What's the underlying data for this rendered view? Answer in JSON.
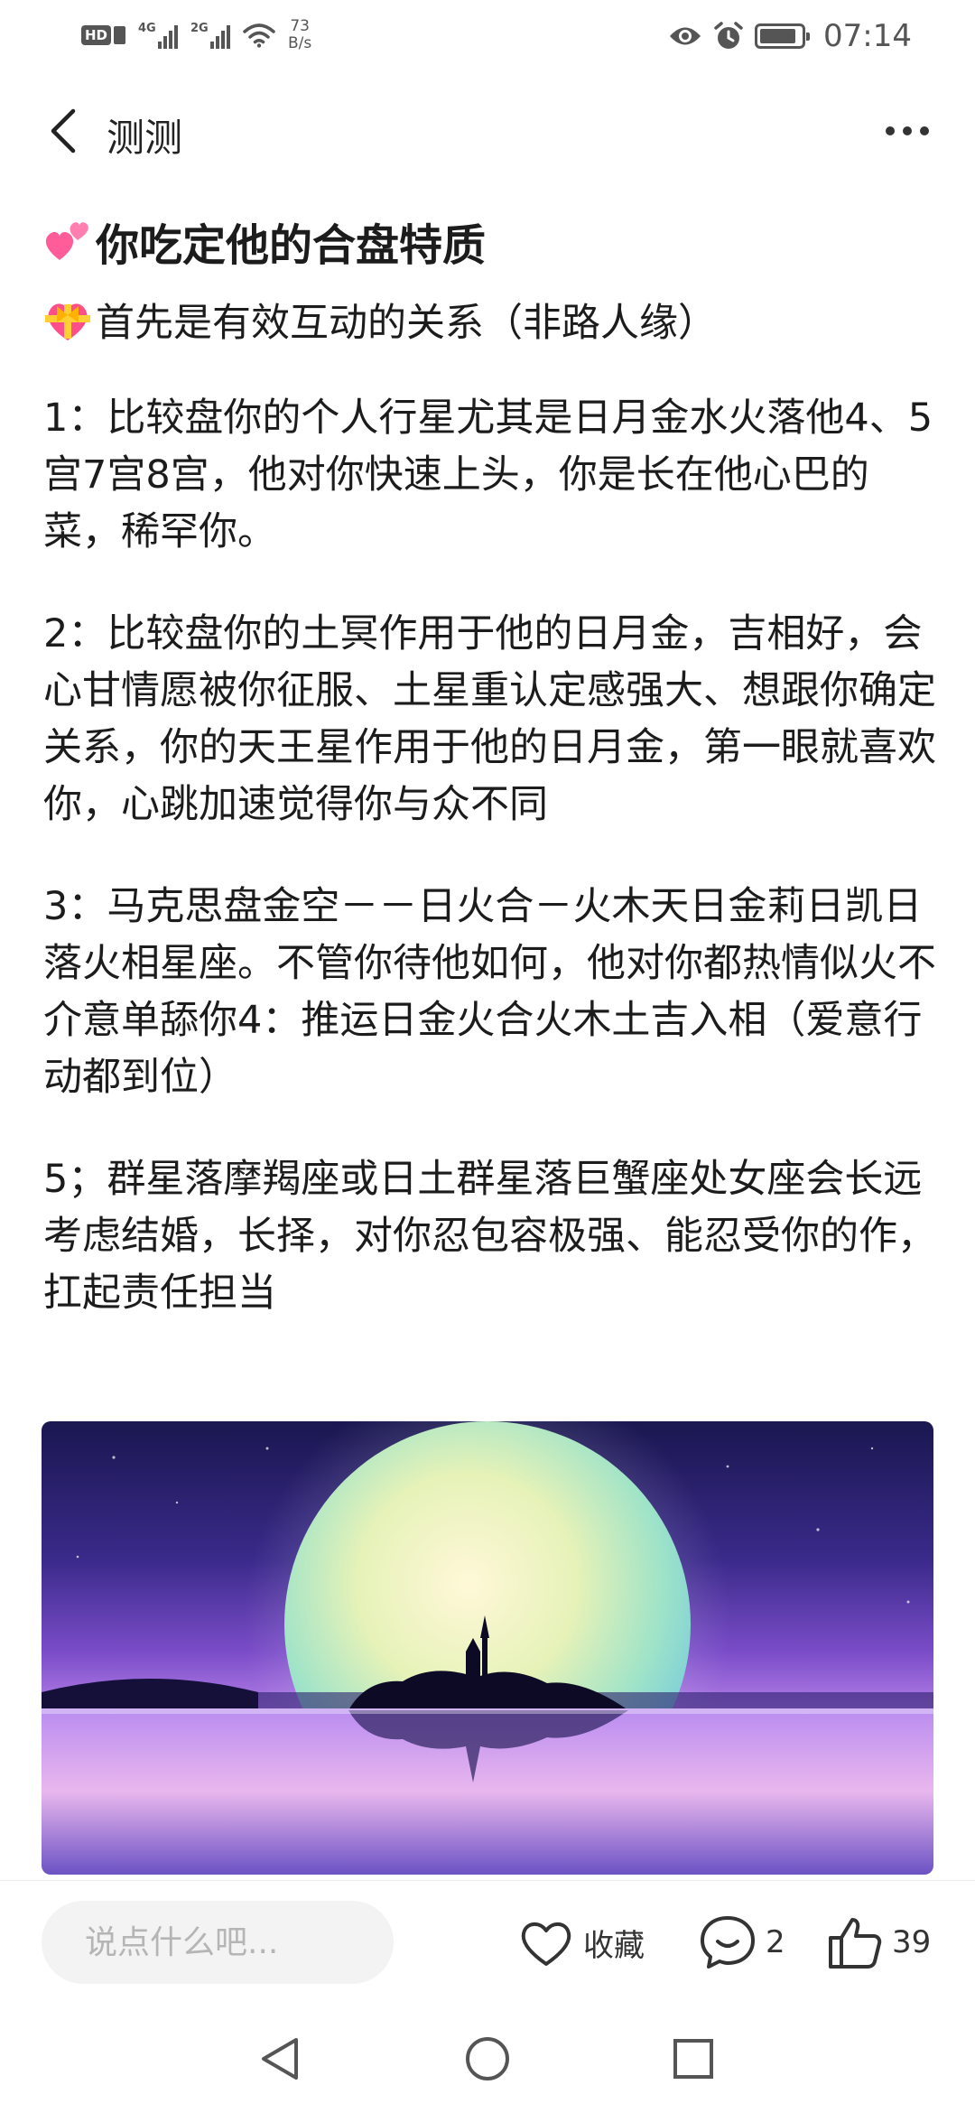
{
  "status_bar": {
    "hd_label": "HD",
    "network_1": "4G",
    "network_2": "2G",
    "speed_value": "73",
    "speed_unit": "B/s",
    "time": "07:14",
    "icons": [
      "hd-icon",
      "sim-icon",
      "signal-icon",
      "wifi-icon",
      "eye-icon",
      "alarm-icon",
      "battery-icon"
    ]
  },
  "header": {
    "title": "测测",
    "back_icon": "chevron-left-icon",
    "more_icon": "more-horizontal-icon"
  },
  "post": {
    "title": "你吃定他的合盘特质",
    "title_emoji": "two-hearts-emoji",
    "subtitle": "首先是有效互动的关系（非路人缘）",
    "subtitle_emoji": "heart-with-ribbon-emoji",
    "paragraphs": [
      "1：比较盘你的个人行星尤其是日月金水火落他4、5宫7宫8宫，他对你快速上头，你是长在他心巴的菜，稀罕你。",
      "2：比较盘你的土冥作用于他的日月金，吉相好，会心甘情愿被你征服、土星重认定感强大、想跟你确定关系，你的天王星作用于他的日月金，第一眼就喜欢你，心跳加速觉得你与众不同",
      "3：马克思盘金空－－日火合－火木天日金莉日凯日落火相星座。不管你待他如何，他对你都热情似火不介意单舔你4：推运日金火合火木土吉入相（爱意行动都到位）",
      "5；群星落摩羯座或日土群星落巨蟹座处女座会长远考虑结婚，长择，对你忍包容极强、能忍受你的作，扛起责任担当"
    ],
    "image": "moon-over-lake-island-image"
  },
  "action_bar": {
    "comment_placeholder": "说点什么吧...",
    "favorite_label": "收藏",
    "comment_count": "2",
    "like_count": "39",
    "icons": [
      "heart-outline-icon",
      "comment-bubble-icon",
      "thumbs-up-icon"
    ]
  },
  "nav_bar": {
    "icons": [
      "nav-back-icon",
      "nav-home-icon",
      "nav-recent-icon"
    ]
  },
  "colors": {
    "text": "#1c1c1c",
    "muted": "#555555",
    "input_bg": "#f3f3f3",
    "placeholder": "#b5b5b5"
  }
}
